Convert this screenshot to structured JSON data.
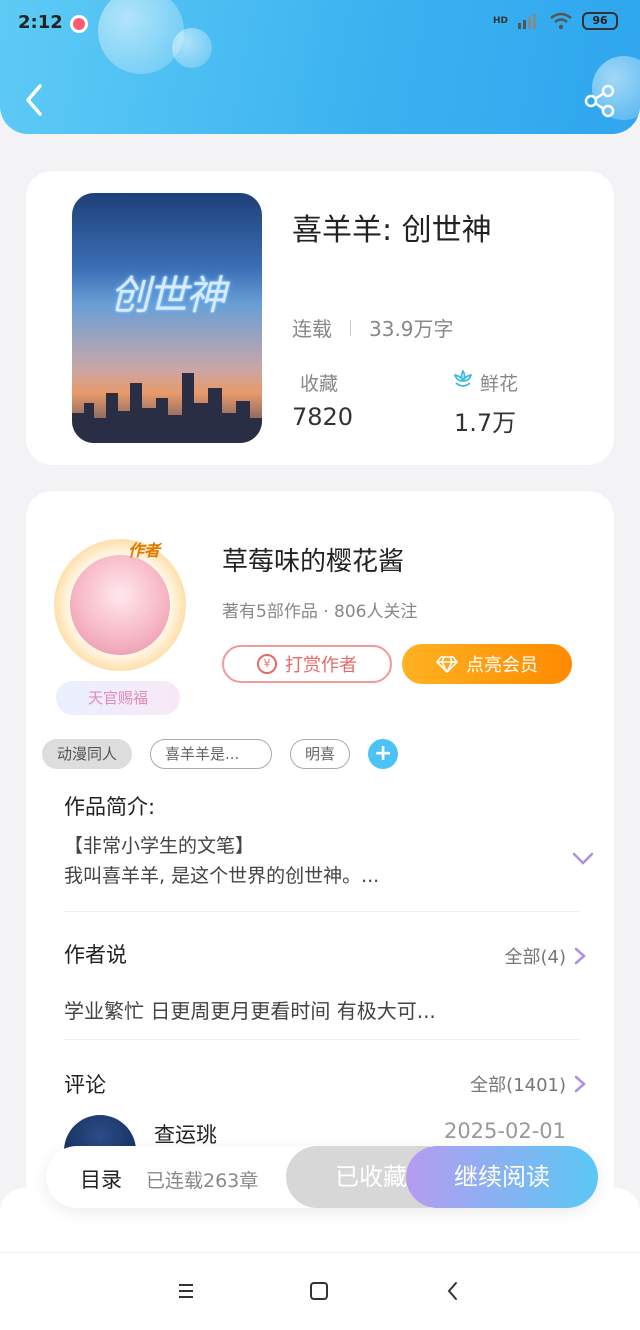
{
  "status_bar": {
    "time": "2:12",
    "network": "HD",
    "battery": "96"
  },
  "header": {
    "back_icon": "chevron-left-icon",
    "share_icon": "share-icon"
  },
  "book": {
    "title": "喜羊羊: 创世神",
    "cover_title": "创世神",
    "status": "连载",
    "word_count": "33.9万字",
    "favorites_label": "收藏",
    "favorites_value": "7820",
    "flowers_label": "鲜花",
    "flowers_value": "1.7万"
  },
  "author": {
    "name": "草莓味的樱花酱",
    "meta": "著有5部作品 · 806人关注",
    "avatar_badge": "作者",
    "avatar_tag": "天官赐福",
    "tip_label": "打赏作者",
    "vip_label": "点亮会员"
  },
  "tags": [
    "动漫同人",
    "喜羊羊是...",
    "明喜"
  ],
  "intro": {
    "title": "作品简介:",
    "line1": "【非常小学生的文笔】",
    "line2": "我叫喜羊羊, 是这个世界的创世神。..."
  },
  "author_says": {
    "title": "作者说",
    "more": "全部(4)",
    "text": "学业繁忙 日更周更月更看时间 有极大可..."
  },
  "comments": {
    "title": "评论",
    "more": "全部(1401)",
    "first": {
      "name": "查运珧",
      "date": "2025-02-01"
    }
  },
  "action_bar": {
    "toc": "目录",
    "chapters": "已连载263章",
    "collected": "已收藏",
    "continue": "继续阅读"
  },
  "colors": {
    "accent_blue": "#3ab2f0",
    "vip_orange": "#ff8a00",
    "tip_red": "#e66a6a"
  }
}
